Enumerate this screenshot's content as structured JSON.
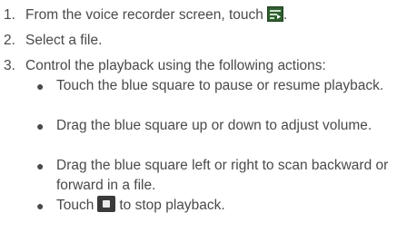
{
  "steps": [
    {
      "num": "1.",
      "text_before": "From the voice recorder screen, touch",
      "icon": "recording-list-icon",
      "text_after": "."
    },
    {
      "num": "2.",
      "text": "Select a file."
    },
    {
      "num": "3.",
      "text": "Control the playback using the following actions:"
    }
  ],
  "bullets": [
    {
      "text": "Touch the blue square to pause or resume playback."
    },
    {
      "text": "Drag the blue square up or down to adjust volume."
    },
    {
      "text": "Drag the blue square left or right to scan backward or forward in a file."
    },
    {
      "text_before": "Touch",
      "icon": "stop-icon",
      "text_after": "to stop playback."
    }
  ],
  "colors": {
    "text": "#4a4a4a",
    "list_icon_bg": "#2f5f2f",
    "stop_icon_bg": "#3a3a3a"
  }
}
